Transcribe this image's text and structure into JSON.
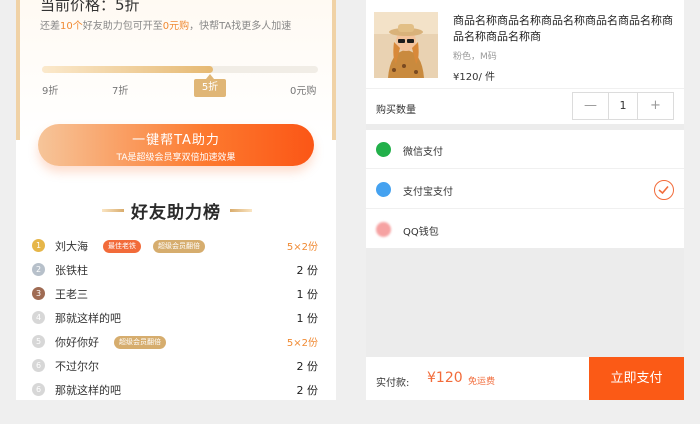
{
  "left": {
    "price_text": "当前价格：5折",
    "sub": {
      "a": "还差",
      "b": "10个",
      "c": "好友助力包可开至",
      "d": "0元购",
      "e": "，快帮TA找更多人加速"
    },
    "progress": {
      "percent": 62,
      "ticks": [
        "9折",
        "7折",
        "5折",
        "0元购"
      ],
      "active": "5折"
    },
    "help_button": {
      "title": "一键帮TA助力",
      "subtitle": "TA是超级会员享双倍加速效果"
    },
    "rank_title": "好友助力榜",
    "rank": [
      {
        "num": "1",
        "name": "刘大海",
        "tags": [
          "最佳老铁",
          "超级会员翻倍"
        ],
        "value": "5×2份",
        "highlight": true
      },
      {
        "num": "2",
        "name": "张铁柱",
        "tags": [],
        "value": "2 份",
        "highlight": false
      },
      {
        "num": "3",
        "name": "王老三",
        "tags": [],
        "value": "1 份",
        "highlight": false
      },
      {
        "num": "4",
        "name": "那就这样的吧",
        "tags": [],
        "value": "1 份",
        "highlight": false
      },
      {
        "num": "5",
        "name": "你好你好",
        "tags": [
          "超级会员翻倍"
        ],
        "value": "5×2份",
        "highlight": true
      },
      {
        "num": "6",
        "name": "不过尔尔",
        "tags": [],
        "value": "2 份",
        "highlight": false
      },
      {
        "num": "6",
        "name": "那就这样的吧",
        "tags": [],
        "value": "2 份",
        "highlight": false
      }
    ]
  },
  "right": {
    "product": {
      "name": "商品名称商品名称商品名称商品名商品名称商品名称商品名称商",
      "spec": "粉色，M码",
      "price": "¥120/ 件"
    },
    "quantity": {
      "label": "购买数量",
      "minus": "—",
      "value": "1",
      "plus": "+"
    },
    "payments": [
      {
        "label": "微信支付",
        "icon": "wechat-icon",
        "color": "#22b04a",
        "selected": false
      },
      {
        "label": "支付宝支付",
        "icon": "alipay-icon",
        "color": "#45a2f0",
        "selected": true
      },
      {
        "label": "QQ钱包",
        "icon": "qq-icon",
        "color": "#f6a2a2",
        "selected": false
      }
    ],
    "bottom": {
      "label": "实付款:",
      "total": "¥120",
      "free_ship": "免运费",
      "buy": "立即支付"
    }
  },
  "colors": {
    "accent": "#fb5a16",
    "gold": "#e0b676"
  }
}
